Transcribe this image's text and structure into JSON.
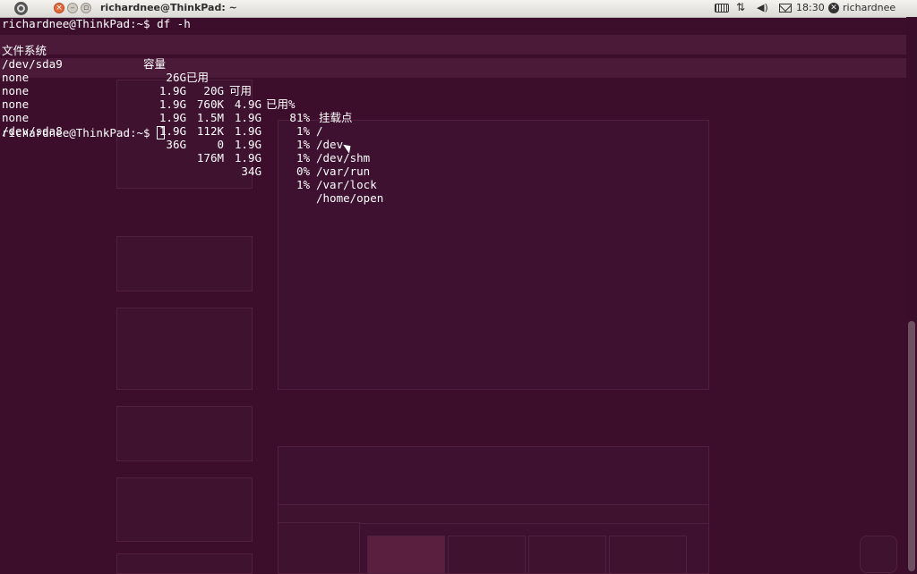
{
  "panel": {
    "window_title": "richardnee@ThinkPad: ~",
    "clock": "18:30",
    "username": "richardnee",
    "icons": [
      "ubuntu-logo-icon",
      "keyboard-icon",
      "network-icon",
      "volume-icon",
      "mail-icon",
      "user-icon"
    ]
  },
  "terminal": {
    "prompt1": "richardnee@ThinkPad:~$ df -h",
    "header": {
      "filesystem": "文件系统",
      "size": "容量",
      "used": "已用",
      "avail": "可用",
      "use_pct": "已用%",
      "mounted": "挂载点"
    },
    "rows": [
      {
        "fs": "/dev/sda9",
        "size": "26G",
        "used": "20G",
        "avail": "4.9G",
        "pct": "81%",
        "mount": "/"
      },
      {
        "fs": "none",
        "size": "1.9G",
        "used": "760K",
        "avail": "1.9G",
        "pct": "1%",
        "mount": "/dev"
      },
      {
        "fs": "none",
        "size": "1.9G",
        "used": "1.5M",
        "avail": "1.9G",
        "pct": "1%",
        "mount": "/dev/shm"
      },
      {
        "fs": "none",
        "size": "1.9G",
        "used": "112K",
        "avail": "1.9G",
        "pct": "1%",
        "mount": "/var/run"
      },
      {
        "fs": "none",
        "size": "1.9G",
        "used": "0",
        "avail": "1.9G",
        "pct": "0%",
        "mount": "/var/lock"
      },
      {
        "fs": "/dev/sda8",
        "size": "36G",
        "used": "176M",
        "avail": "34G",
        "pct": "1%",
        "mount": "/home/open"
      }
    ],
    "prompt2": "richardnee@ThinkPad:~$ "
  },
  "colors": {
    "terminal_bg": "#3c0e2c",
    "terminal_fg": "#ffffff",
    "panel_bg": "#dcdad5",
    "close_button": "#e5693b"
  }
}
